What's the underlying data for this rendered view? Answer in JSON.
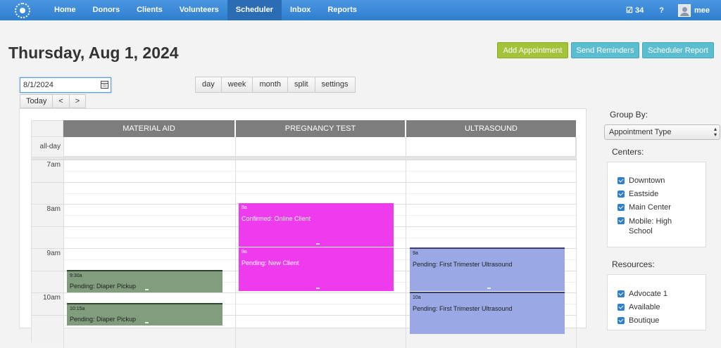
{
  "nav": {
    "items": [
      "Home",
      "Donors",
      "Clients",
      "Volunteers",
      "Scheduler",
      "Inbox",
      "Reports"
    ],
    "active": "Scheduler",
    "tasks_count": "34",
    "help": "?",
    "username": "mee"
  },
  "page": {
    "title": "Thursday, Aug 1, 2024"
  },
  "actions": {
    "add": "Add Appointment",
    "remind": "Send Reminders",
    "report": "Scheduler Report"
  },
  "date_input": {
    "value": "8/1/2024"
  },
  "nav_buttons": {
    "today": "Today",
    "prev": "<",
    "next": ">"
  },
  "views": [
    "day",
    "week",
    "month",
    "split",
    "settings"
  ],
  "calendar": {
    "columns": [
      "MATERIAL AID",
      "PREGNANCY TEST",
      "ULTRASOUND"
    ],
    "allday_label": "all-day",
    "hours": [
      "7am",
      "8am",
      "9am",
      "10am"
    ],
    "events": [
      {
        "time": "8a",
        "text": "Confirmed: Online Client",
        "color": "#ee3bee"
      },
      {
        "time": "9a",
        "text": "Pending: New Client",
        "color": "#ee3bee"
      },
      {
        "time": "9a",
        "text": "Pending: First Trimester Ultrasound",
        "color": "#9aa8e6"
      },
      {
        "time": "10a",
        "text": "Pending: First Trimester Ultrasound",
        "color": "#9aa8e6"
      },
      {
        "time": "9:30a",
        "text": "Pending: Diaper Pickup",
        "color": "#819d7e"
      },
      {
        "time": "10:15a",
        "text": "Pending: Diaper Pickup",
        "color": "#819d7e"
      }
    ]
  },
  "sidebar": {
    "group_by_label": "Group By:",
    "group_by_value": "Appointment Type",
    "centers_label": "Centers:",
    "centers": [
      "Downtown",
      "Eastside",
      "Main Center",
      "Mobile: High School"
    ],
    "resources_label": "Resources:",
    "resources": [
      "Advocate 1",
      "Available",
      "Boutique"
    ]
  }
}
